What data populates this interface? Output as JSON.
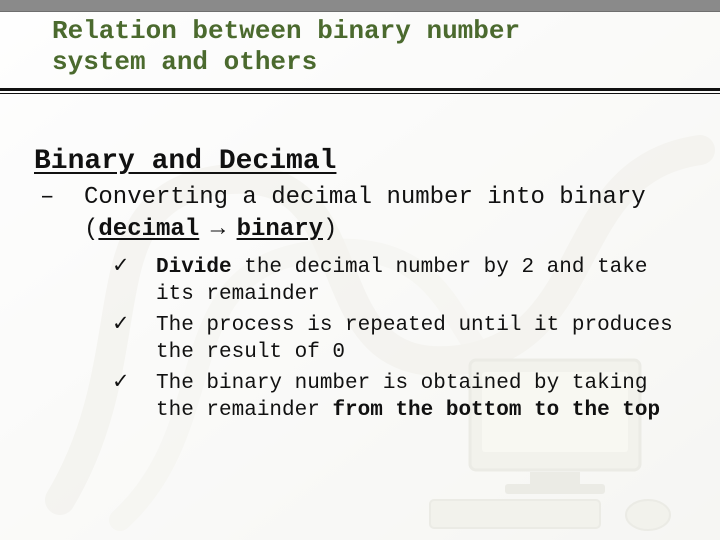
{
  "title_line1": "Relation between binary number",
  "title_line2": "system and others",
  "section": "Binary and Decimal",
  "sub": {
    "dash": "–",
    "prefix": "Converting a decimal number into binary (",
    "from": "decimal",
    "arrow": " → ",
    "to": "binary",
    "suffix": ")"
  },
  "items": [
    {
      "check": "✓",
      "pre": "",
      "bold1": "Divide",
      "mid": " the decimal number by 2 and take its remainder",
      "bold2": "",
      "post": ""
    },
    {
      "check": "✓",
      "pre": "The process is repeated until it produces the result of 0",
      "bold1": "",
      "mid": "",
      "bold2": "",
      "post": ""
    },
    {
      "check": "✓",
      "pre": "The binary number is obtained by taking the remainder ",
      "bold1": "",
      "mid": "",
      "bold2": "from the bottom to the top",
      "post": ""
    }
  ]
}
